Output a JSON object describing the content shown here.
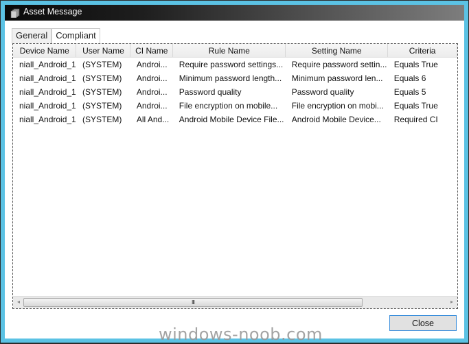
{
  "window": {
    "title": "Asset Message",
    "icon": "stacked-documents-icon"
  },
  "tabs": [
    {
      "label": "General",
      "active": false
    },
    {
      "label": "Compliant",
      "active": true
    }
  ],
  "table": {
    "columns": [
      "Device Name",
      "User Name",
      "CI Name",
      "Rule Name",
      "Setting Name",
      "Criteria"
    ],
    "rows": [
      [
        "niall_Android_1",
        "(SYSTEM)",
        "Androi...",
        "Require password settings...",
        "Require password settin...",
        "Equals True"
      ],
      [
        "niall_Android_1",
        "(SYSTEM)",
        "Androi...",
        "Minimum password length...",
        "Minimum password len...",
        "Equals 6"
      ],
      [
        "niall_Android_1",
        "(SYSTEM)",
        "Androi...",
        "Password quality",
        "Password quality",
        "Equals 5"
      ],
      [
        "niall_Android_1",
        "(SYSTEM)",
        "Androi...",
        "File encryption on mobile...",
        "File encryption on mobi...",
        "Equals True"
      ],
      [
        "niall_Android_1",
        "(SYSTEM)",
        "All And...",
        "Android Mobile Device File...",
        "Android Mobile Device...",
        "Required CI"
      ]
    ]
  },
  "scrollbar": {
    "left_arrow": "◂",
    "right_arrow": "▸",
    "grip": "III"
  },
  "buttons": {
    "close_label": "Close"
  },
  "watermark": "windows-noob.com",
  "colors": {
    "frame": "#5bc2e4",
    "button_border": "#3c8fdc"
  }
}
